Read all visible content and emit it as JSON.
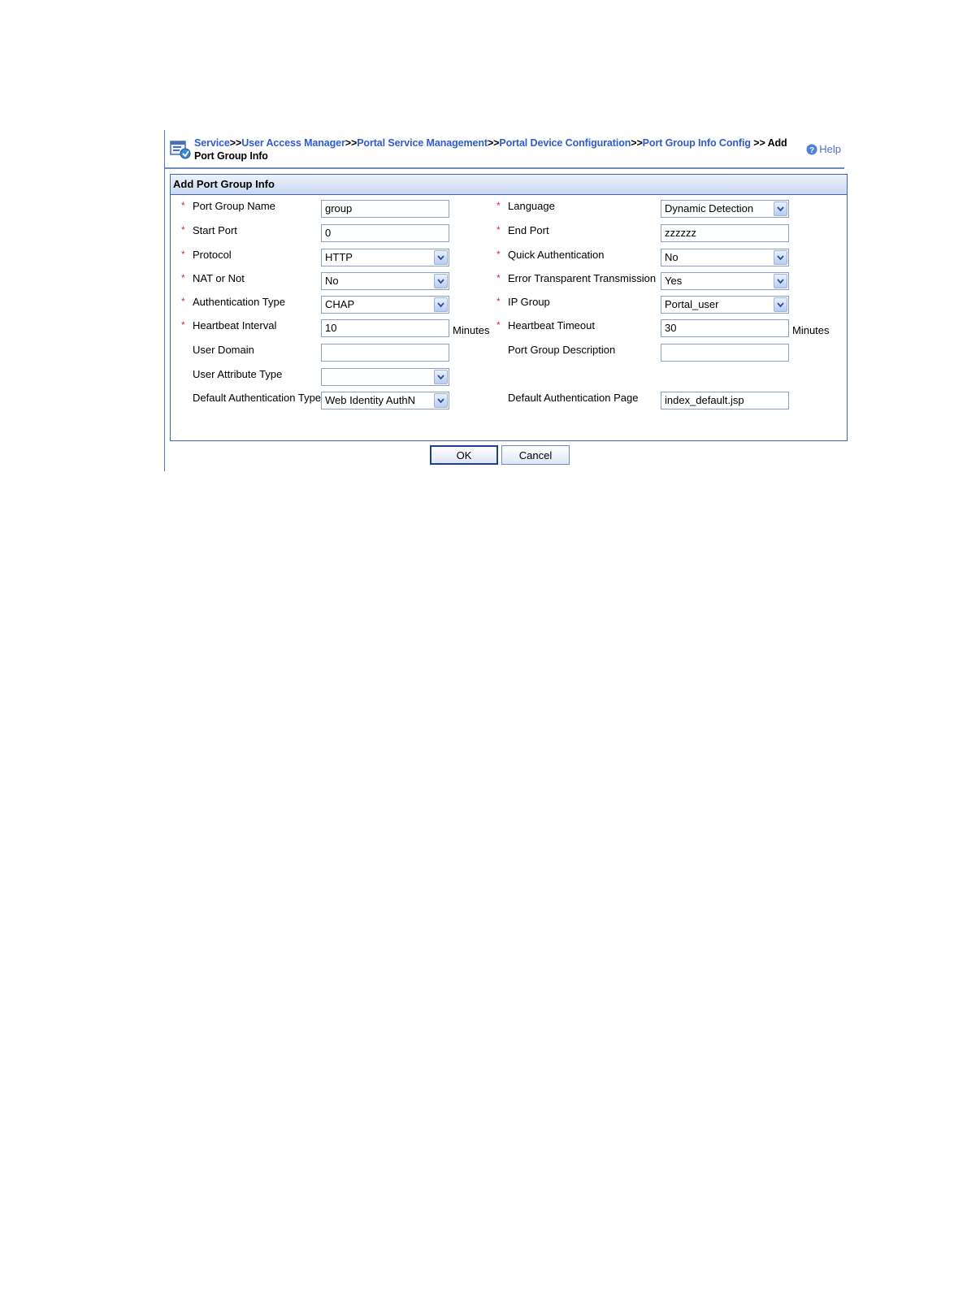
{
  "breadcrumb": {
    "items": [
      "Service",
      "User Access Manager",
      "Portal Service Management",
      "Portal Device Configuration",
      "Port Group Info Config"
    ],
    "separator": ">>",
    "current_sep": " >> ",
    "current": "Add Port Group Info"
  },
  "help_label": "Help",
  "panel": {
    "title": "Add Port Group Info"
  },
  "form": {
    "left": [
      {
        "label": "Port Group Name",
        "required": true,
        "type": "text",
        "value": "group"
      },
      {
        "label": "Start Port",
        "required": true,
        "type": "text",
        "value": "0"
      },
      {
        "label": "Protocol",
        "required": true,
        "type": "select",
        "value": "HTTP"
      },
      {
        "label": "NAT or Not",
        "required": true,
        "type": "select",
        "value": "No"
      },
      {
        "label": "Authentication Type",
        "required": true,
        "type": "select",
        "value": "CHAP"
      },
      {
        "label": "Heartbeat Interval",
        "required": true,
        "type": "text",
        "value": "10",
        "unit": "Minutes"
      },
      {
        "label": "User Domain",
        "required": false,
        "type": "text",
        "value": ""
      },
      {
        "label": "User Attribute Type",
        "required": false,
        "type": "select",
        "value": ""
      },
      {
        "label": "Default Authentication Type",
        "required": false,
        "type": "select",
        "value": "Web Identity AuthN"
      }
    ],
    "right": [
      {
        "label": "Language",
        "required": true,
        "type": "select",
        "value": "Dynamic Detection"
      },
      {
        "label": "End Port",
        "required": true,
        "type": "text",
        "value": "zzzzzz"
      },
      {
        "label": "Quick Authentication",
        "required": true,
        "type": "select",
        "value": "No"
      },
      {
        "label": "Error Transparent Transmission",
        "required": true,
        "type": "select",
        "value": "Yes"
      },
      {
        "label": "IP Group",
        "required": true,
        "type": "select",
        "value": "Portal_user"
      },
      {
        "label": "Heartbeat Timeout",
        "required": true,
        "type": "text",
        "value": "30",
        "unit": "Minutes"
      },
      {
        "label": "Port Group Description",
        "required": false,
        "type": "text",
        "value": ""
      },
      null,
      {
        "label": "Default Authentication Page",
        "required": false,
        "type": "text",
        "value": "index_default.jsp"
      }
    ]
  },
  "required_marker": "*",
  "buttons": {
    "ok": "OK",
    "cancel": "Cancel"
  },
  "colors": {
    "link": "#2f5bd3",
    "required": "#d13232",
    "border": "#3f64b6"
  }
}
